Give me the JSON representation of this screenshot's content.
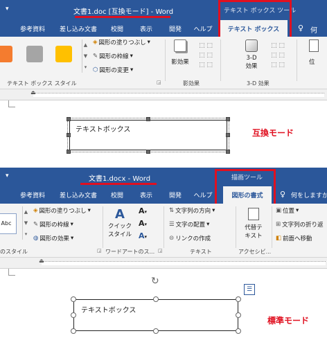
{
  "top": {
    "title": "文書1.doc [互換モード] - Word",
    "context_group": "テキスト ボックス ツール",
    "tabs": [
      "参考資料",
      "差し込み文書",
      "校閲",
      "表示",
      "開発",
      "ヘルプ",
      "テキスト ボックス"
    ],
    "tell_me": "何",
    "ribbon": {
      "fill": "図形の塗りつぶし",
      "outline": "図形の枠線",
      "change": "図形の変更",
      "styles_group": "テキスト ボックス スタイル",
      "shadow": "影効果",
      "shadow_group": "影効果",
      "threed": "3-D",
      "threed2": "効果",
      "threed_group": "3-D 効果",
      "position": "位"
    },
    "swatch_colors": [
      "#f47c2f",
      "#a5a5a5",
      "#ffc000"
    ],
    "textbox_text": "テキストボックス",
    "mode_label": "互換モード"
  },
  "bottom": {
    "title": "文書1.docx - Word",
    "context_group": "描画ツール",
    "tabs": [
      "参考資料",
      "差し込み文書",
      "校閲",
      "表示",
      "開発",
      "ヘルプ",
      "図形の書式"
    ],
    "tell_me": "何をしますか",
    "ribbon": {
      "abc": "Abc",
      "fill": "図形の塗りつぶし",
      "outline": "図形の枠線",
      "effect": "図形の効果",
      "styles_group": "のスタイル",
      "quick1": "クイック",
      "quick2": "スタイル",
      "wordart_group": "ワードアートのス...",
      "text_dir": "文字列の方向",
      "text_align": "文字の配置",
      "link": "リンクの作成",
      "text_group": "テキスト",
      "alt1": "代替テ",
      "alt2": "キスト",
      "access_group": "アクセシビ...",
      "position": "位置",
      "wrap": "文字列の折り返",
      "front": "前面へ移動"
    },
    "textbox_text": "テキストボックス",
    "mode_label": "標準モード"
  },
  "colors": {
    "title": "#2b579a",
    "accent_red": "#e01020"
  }
}
